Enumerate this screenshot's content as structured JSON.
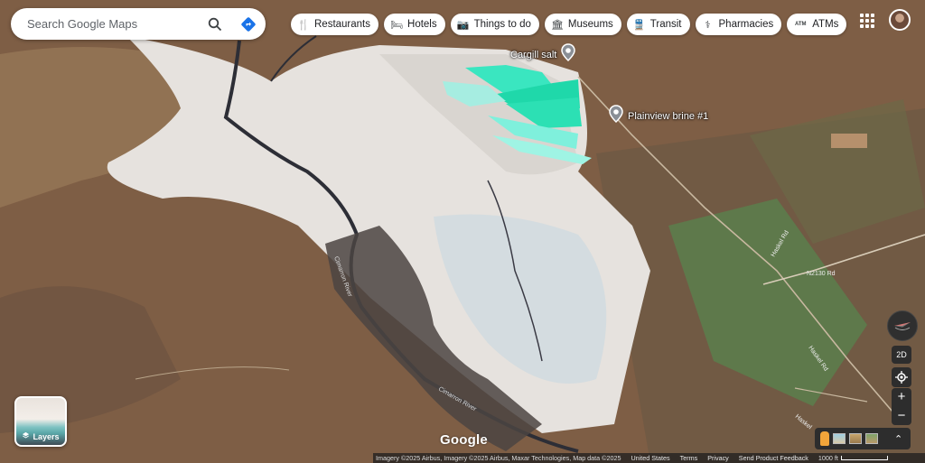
{
  "search": {
    "placeholder": "Search Google Maps"
  },
  "chips": [
    {
      "label": "Restaurants",
      "icon": "fork-knife-icon"
    },
    {
      "label": "Hotels",
      "icon": "bed-icon"
    },
    {
      "label": "Things to do",
      "icon": "camera-icon"
    },
    {
      "label": "Museums",
      "icon": "museum-icon"
    },
    {
      "label": "Transit",
      "icon": "train-icon"
    },
    {
      "label": "Pharmacies",
      "icon": "pharmacy-icon"
    },
    {
      "label": "ATMs",
      "icon": "atm-icon"
    }
  ],
  "atm_glyph": "ATM",
  "pois": [
    {
      "label": "Cargill salt"
    },
    {
      "label": "Plainview brine #1"
    }
  ],
  "road_labels": [
    "N2130 Rd",
    "Haskel Rd",
    "Haskel Rd",
    "Cimarron River",
    "Cimarron River",
    "Haskel"
  ],
  "layers": {
    "label": "Layers"
  },
  "logo": "Google",
  "controls": {
    "view_mode": "2D",
    "zoom_in": "+",
    "zoom_out": "−"
  },
  "footer": {
    "attribution": "Imagery ©2025 Airbus, Imagery ©2025 Airbus, Maxar Technologies, Map data ©2025",
    "country": "United States",
    "terms": "Terms",
    "privacy": "Privacy",
    "feedback": "Send Product Feedback",
    "scale": "1000 ft"
  },
  "colors": {
    "salt_ponds": "#2fe0b8",
    "chip_bg": "#ffffff",
    "directions": "#1a73e8"
  }
}
